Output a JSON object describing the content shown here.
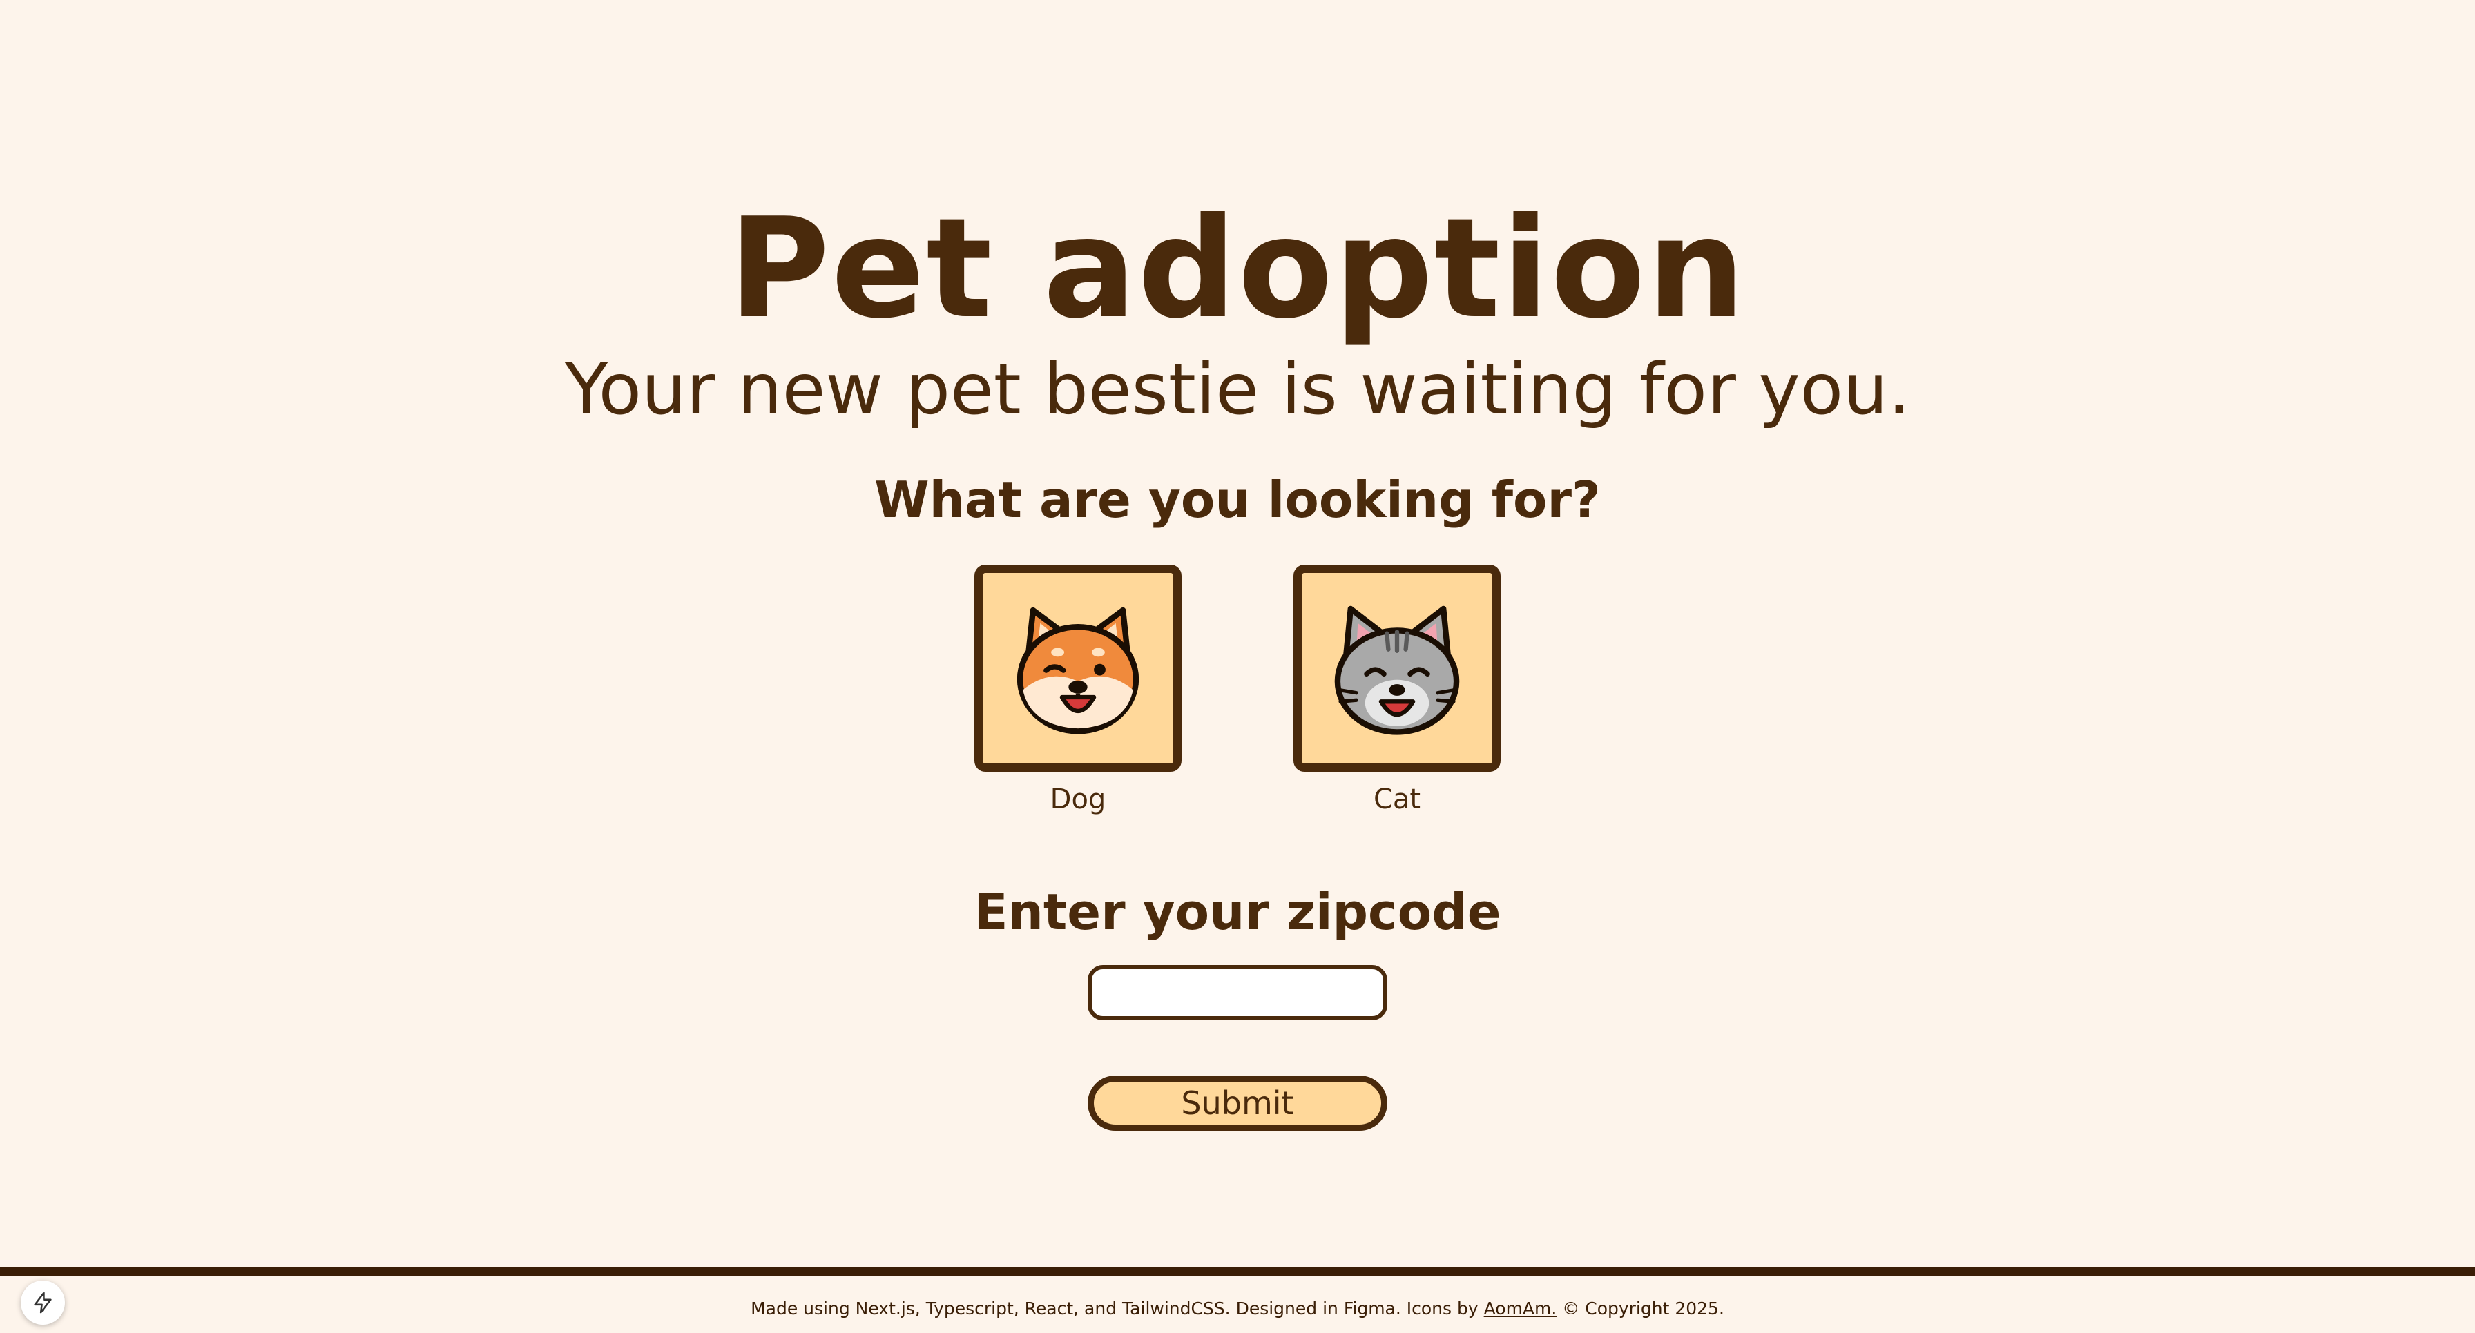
{
  "hero": {
    "title": "Pet adoption",
    "subtitle": "Your new pet bestie is waiting for you.",
    "question": "What are you looking for?"
  },
  "pets": [
    {
      "label": "Dog",
      "icon": "dog-face-icon"
    },
    {
      "label": "Cat",
      "icon": "cat-face-icon"
    }
  ],
  "zipcode": {
    "heading": "Enter your zipcode",
    "value": "",
    "placeholder": ""
  },
  "submit": {
    "label": "Submit"
  },
  "footer": {
    "prefix": "Made using Next.js, Typescript, React, and TailwindCSS. Designed in Figma. Icons by ",
    "link": "AomAm.",
    "suffix": " © Copyright 2025."
  },
  "colors": {
    "background": "#fdf4eb",
    "ink": "#4a2a0c",
    "card": "#ffd89a"
  }
}
